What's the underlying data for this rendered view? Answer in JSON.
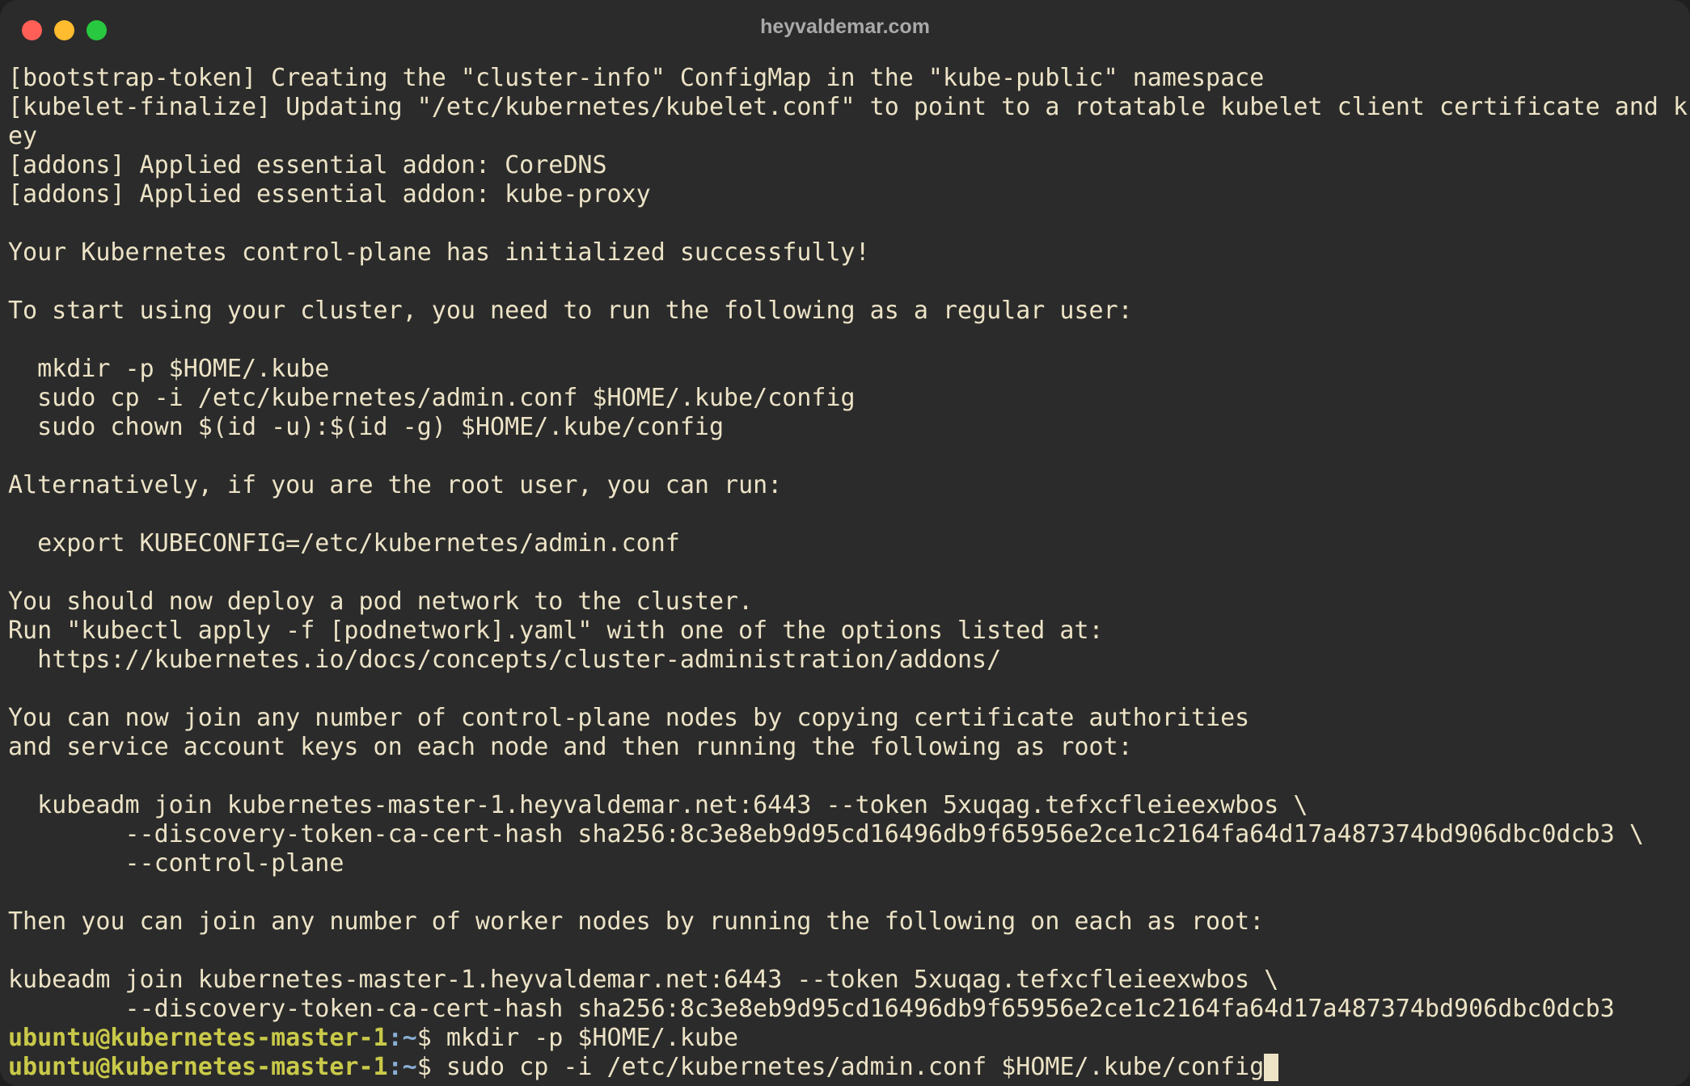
{
  "window": {
    "title": "heyvaldemar.com"
  },
  "terminal": {
    "output_lines": [
      "[bootstrap-token] Creating the \"cluster-info\" ConfigMap in the \"kube-public\" namespace",
      "[kubelet-finalize] Updating \"/etc/kubernetes/kubelet.conf\" to point to a rotatable kubelet client certificate and k",
      "ey",
      "[addons] Applied essential addon: CoreDNS",
      "[addons] Applied essential addon: kube-proxy",
      "",
      "Your Kubernetes control-plane has initialized successfully!",
      "",
      "To start using your cluster, you need to run the following as a regular user:",
      "",
      "  mkdir -p $HOME/.kube",
      "  sudo cp -i /etc/kubernetes/admin.conf $HOME/.kube/config",
      "  sudo chown $(id -u):$(id -g) $HOME/.kube/config",
      "",
      "Alternatively, if you are the root user, you can run:",
      "",
      "  export KUBECONFIG=/etc/kubernetes/admin.conf",
      "",
      "You should now deploy a pod network to the cluster.",
      "Run \"kubectl apply -f [podnetwork].yaml\" with one of the options listed at:",
      "  https://kubernetes.io/docs/concepts/cluster-administration/addons/",
      "",
      "You can now join any number of control-plane nodes by copying certificate authorities",
      "and service account keys on each node and then running the following as root:",
      "",
      "  kubeadm join kubernetes-master-1.heyvaldemar.net:6443 --token 5xuqag.tefxcfleieexwbos \\",
      "        --discovery-token-ca-cert-hash sha256:8c3e8eb9d95cd16496db9f65956e2ce1c2164fa64d17a487374bd906dbc0dcb3 \\",
      "        --control-plane",
      "",
      "Then you can join any number of worker nodes by running the following on each as root:",
      "",
      "kubeadm join kubernetes-master-1.heyvaldemar.net:6443 --token 5xuqag.tefxcfleieexwbos \\",
      "        --discovery-token-ca-cert-hash sha256:8c3e8eb9d95cd16496db9f65956e2ce1c2164fa64d17a487374bd906dbc0dcb3"
    ],
    "prompts": [
      {
        "user_host": "ubuntu@kubernetes-master-1",
        "path": ":~",
        "symbol": "$",
        "command": " mkdir -p $HOME/.kube"
      },
      {
        "user_host": "ubuntu@kubernetes-master-1",
        "path": ":~",
        "symbol": "$",
        "command": " sudo cp -i /etc/kubernetes/admin.conf $HOME/.kube/config"
      }
    ]
  },
  "colors": {
    "background": "#2b2b2b",
    "text": "#ece3c6",
    "prompt_user": "#c9c94a",
    "prompt_path": "#8ab0d6",
    "close": "#ff5f57",
    "minimize": "#febc2e",
    "zoom": "#28c840"
  }
}
